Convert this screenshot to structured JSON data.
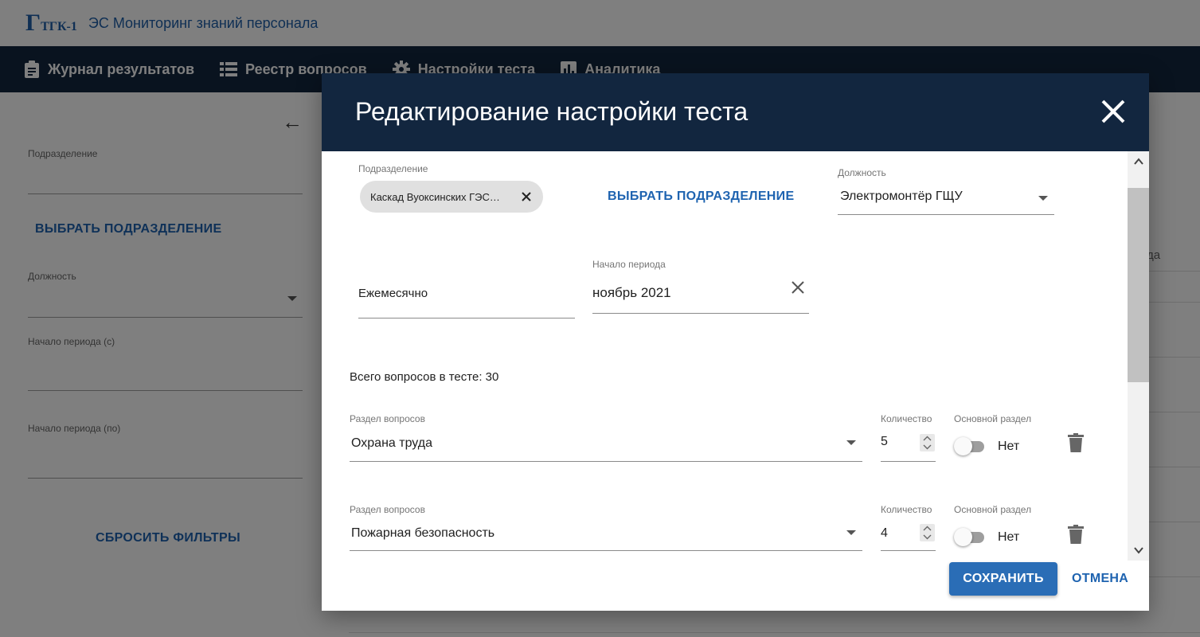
{
  "app": {
    "logo_text": "Г",
    "logo_sub": "ТГК-1",
    "title": "ЭС Мониторинг знаний персонала"
  },
  "nav": {
    "items": [
      {
        "label": "Журнал результатов",
        "icon": "clipboard-icon"
      },
      {
        "label": "Реестр вопросов",
        "icon": "list-icon"
      },
      {
        "label": "Настройки теста",
        "icon": "gear-icon"
      },
      {
        "label": "Аналитика",
        "icon": "bar-chart-icon"
      }
    ]
  },
  "filters": {
    "division_label": "Подразделение",
    "select_division": "ВЫБРАТЬ ПОДРАЗДЕЛЕНИЕ",
    "position_label": "Должность",
    "period_from_label": "Начало периода (с)",
    "period_to_label": "Начало периода (по)",
    "reset": "СБРОСИТЬ ФИЛЬТРЫ"
  },
  "background_table": {
    "partial_header": "да"
  },
  "modal": {
    "title": "Редактирование настройки теста",
    "division_label": "Подразделение",
    "division_chip": "Каскад Вуоксинских ГЭС…",
    "select_division": "ВЫБРАТЬ ПОДРАЗДЕЛЕНИЕ",
    "position_label": "Должность",
    "position_value": "Электромонтёр ГЩУ",
    "frequency": "Ежемесячно",
    "period_label": "Начало периода",
    "period_value": "ноябрь 2021",
    "total_questions": "Всего вопросов в тесте: 30",
    "sections": [
      {
        "section_label": "Раздел вопросов",
        "section_value": "Охрана труда",
        "count_label": "Количество",
        "count": "5",
        "main_label": "Основной раздел",
        "main_value": "Нет"
      },
      {
        "section_label": "Раздел вопросов",
        "section_value": "Пожарная безопасность",
        "count_label": "Количество",
        "count": "4",
        "main_label": "Основной раздел",
        "main_value": "Нет"
      }
    ],
    "save": "СОХРАНИТЬ",
    "cancel": "ОТМЕНА"
  },
  "colors": {
    "nav_bg": "#12263f",
    "accent": "#1e63b0",
    "save_bg": "#2a6db6"
  }
}
